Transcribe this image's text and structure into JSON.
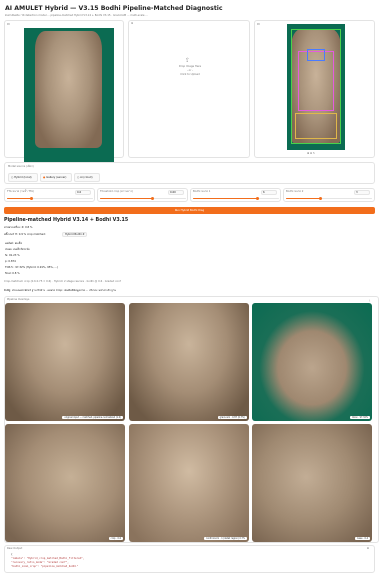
{
  "title": "AI AMULET Hybrid — V3.15 Bodhi Pipeline-Matched Diagnostic",
  "subtitle": "ตั้งค่าเพิ่มเติม: ใช้ detection model ... pipeline-matched Hybrid V3.14 + Bodhi V3.15 · Grad-CAM ... multi-scale ...",
  "inputs": {
    "upload_hint": "Drop Image Here",
    "or": "- or -",
    "click": "Click to Upload"
  },
  "mode": {
    "label": "Model source (เลือก)",
    "options": [
      "Hybrid (local)",
      "Gallery (server)",
      "Ai (cloud)"
    ],
    "selected": 1
  },
  "sliders": [
    {
      "label": "TTA ขนาด (วนซ้ำ TTA)",
      "value": "0.6",
      "fraction": 0.28
    },
    {
      "label": "Threshold crop (ความยาว)",
      "value": "0.60",
      "fraction": 0.6
    },
    {
      "label": "Bodhi ขนาด 1",
      "value": "6",
      "fraction": 0.75
    },
    {
      "label": "Bodhi ขนาด 2",
      "value": "3",
      "fraction": 0.4
    }
  ],
  "run_button": "Run Hybrid Bodhi Diag",
  "result": {
    "heading": "Pipeline-matched Hybrid V3.14 + Bodhi V3.15",
    "line1": "สายพระเครื่อง: Z: 0.8 %",
    "line2": "สติ๊กเกอร์ H: 0.9 % crop matched:",
    "tag": "Hybrid Bodhi Z",
    "stats": [
      "ผลลัพธ์: สมเด็จ",
      "class: สมเด็จวัดระฆัง",
      "fs: 91.23 %",
      "p: 0.874",
      "TOP-5 : 97.32% (Hybrid: 0.91%, 95%, ...)",
      "final: 0.8 %"
    ],
    "note": "Crop-matched: crop (0.6·0.75 = 0.6) · Hybrid: 2 stage rescore · bodhi @ 0.6 · Graded conf",
    "highlight": "สิ่งที่ดู: ส่วนบนพระพักตร์ ฐาน ปีกข้าง · ผลพระ Crop: เน้นพื้นที่ข้อมูลภาพ ... บริเวณ: หน้าอก ตัก ฐาน"
  },
  "gallery": {
    "label": "Pipeline Overlays",
    "captions": [
      "original input — matched, pipeline-normalized (1.0)",
      "grad-cam · 0.87 (0.7%)",
      "bbox · 97.32%",
      "crop · 0.6",
      "bodhi zoom · 1 (detail region) 0.7%",
      "base · 0.4"
    ]
  },
  "json": {
    "label": "Raw Output",
    "lines": [
      "{",
      "  \"labels\": \"Hybrid_crop_matched_Bodhi_filtered\",",
      "  \"recovery_ratio_mode\": \"Graded conf\",",
      "  \"bodhi_zoom_crop\": \"pipeline_matched_bodhi\""
    ]
  },
  "colors": {
    "accent": "#f26d1b",
    "bg_green": "#0b6b52",
    "amulet": "#a8927a"
  }
}
